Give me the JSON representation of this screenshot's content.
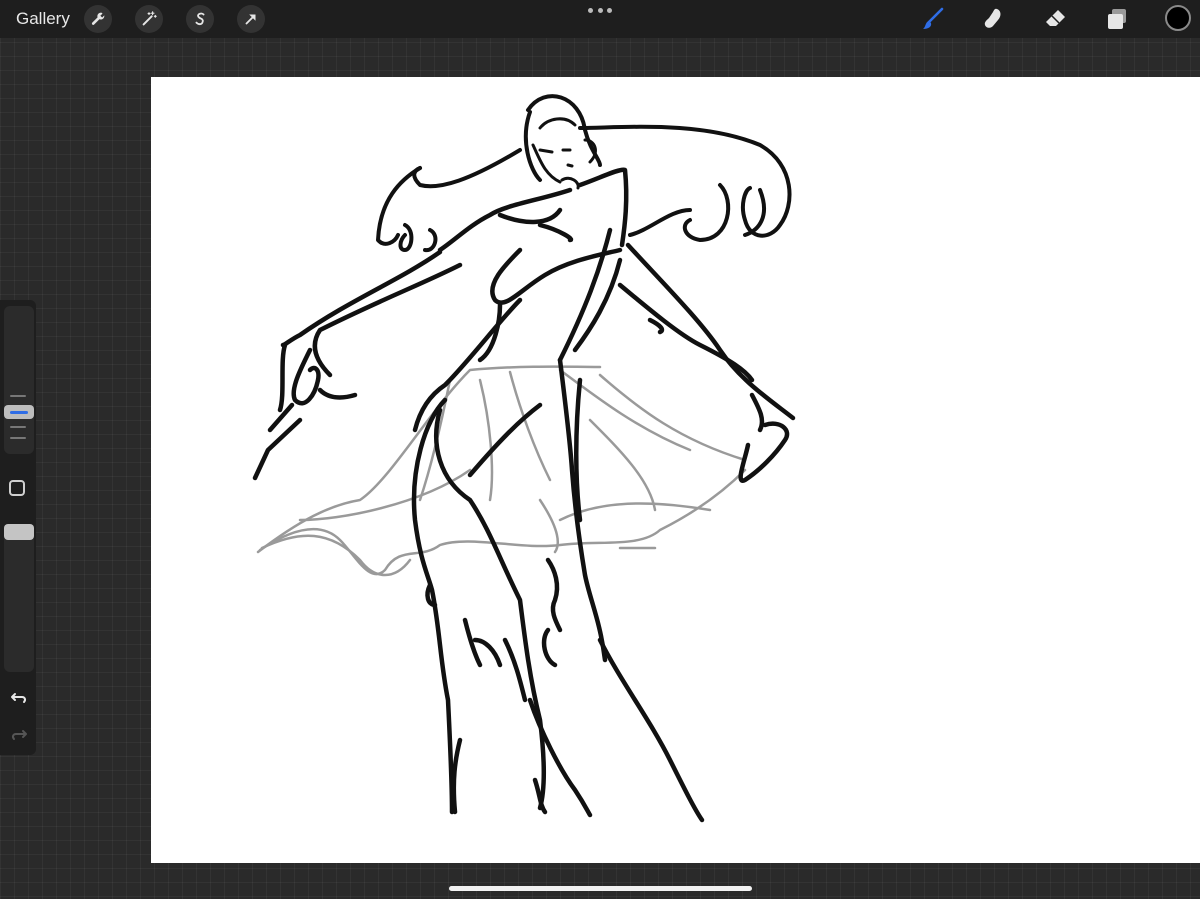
{
  "topbar": {
    "gallery_label": "Gallery"
  },
  "icons": {
    "actions": "wrench-icon",
    "adjustments": "magic-wand-icon",
    "selection": "s-selection-icon",
    "transform": "arrow-cursor-icon",
    "more": "ellipsis-icon",
    "brush": "paintbrush-icon",
    "smudge": "smudge-finger-icon",
    "eraser": "eraser-icon",
    "layers": "layers-icon",
    "color": "color-circle-icon",
    "undo": "undo-arrow-icon",
    "redo": "redo-arrow-icon"
  },
  "colors": {
    "active_tool": "#2f6de6",
    "current_color": "#000000",
    "ui_dark": "#1e1e1e"
  }
}
